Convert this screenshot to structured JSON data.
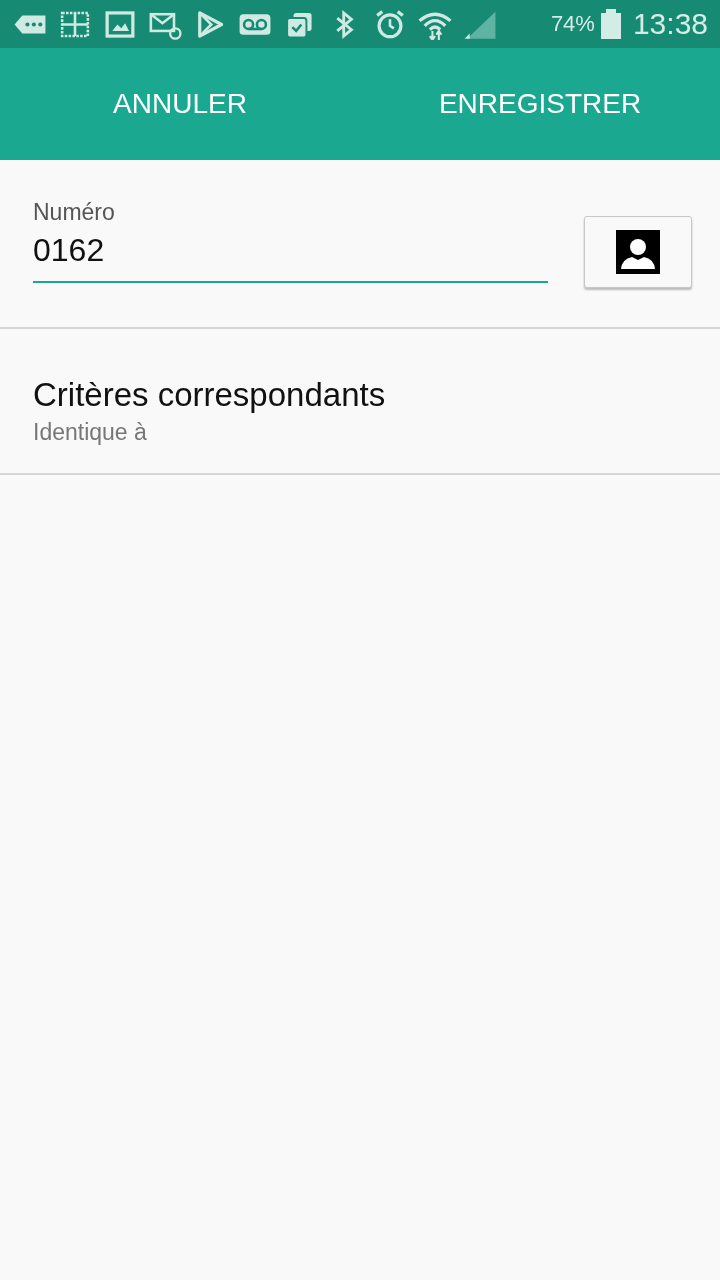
{
  "status_bar": {
    "battery": "74%",
    "time": "13:38"
  },
  "action_bar": {
    "buttons": [
      "ANNULER",
      "ENREGISTRER"
    ]
  },
  "number_field": {
    "label": "Numéro",
    "value": "0162"
  },
  "settings": [
    {
      "title": "Critères correspondants",
      "summary": "Identique à"
    }
  ]
}
